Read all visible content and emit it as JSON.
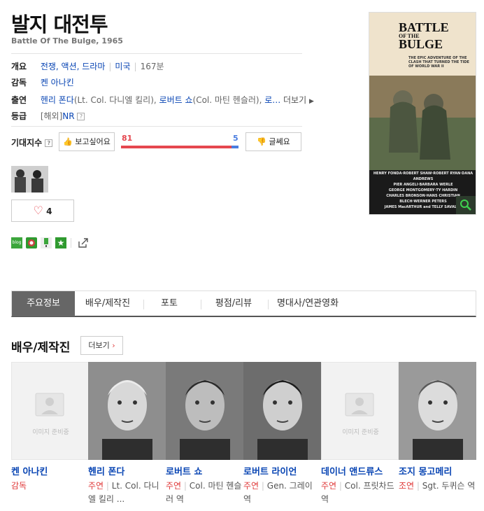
{
  "movie": {
    "title": "발지 대전투",
    "subtitle": "Battle Of The Bulge, 1965"
  },
  "info": {
    "overview_label": "개요",
    "genres": "전쟁, 액션, 드라마",
    "country": "미국",
    "runtime": "167분",
    "director_label": "감독",
    "director": "켄 아나킨",
    "cast_label": "출연",
    "cast_1": "헨리 폰다",
    "cast_1_role": "(Lt. Col. 다니엘 킬리),",
    "cast_2": "로버트 쇼",
    "cast_2_role": "(Col. 마틴 헨슬러),",
    "cast_3": "로…",
    "more_label": "더보기",
    "rating_label": "등급",
    "rating_region": "[해외]",
    "rating_value": "NR",
    "qmark": "?"
  },
  "expect": {
    "label": "기대지수",
    "qmark": "?",
    "want_label": "보고싶어요",
    "meh_label": "글쎄요",
    "want_count": "81",
    "meh_count": "5",
    "want_ratio": 0.942
  },
  "like": {
    "count": "4"
  },
  "share": {
    "blog_label": "blog"
  },
  "poster": {
    "title_line1": "BATTLE",
    "title_line2": "OF THE",
    "title_line3": "BULGE",
    "tagline": "THE EPIC ADVENTURE OF THE CLASH THAT TURNED THE TIDE OF WORLD WAR II",
    "credits_1": "HENRY FONDA·ROBERT SHAW·ROBERT RYAN·DANA ANDREWS",
    "credits_2": "PIER ANGELI·BARBARA WERLE",
    "credits_3": "GEORGE MONTGOMERY·TY HARDIN",
    "credits_4": "CHARLES BRONSON·HANS CHRISTIAN BLECH·WERNER PETERS",
    "credits_5": "JAMES MacARTHUR and TELLY SAVALAS"
  },
  "tabs": [
    "주요정보",
    "배우/제작진",
    "포토",
    "평점/리뷰",
    "명대사/연관영화"
  ],
  "cast_section": {
    "title": "배우/제작진",
    "more_label": "더보기",
    "no_image_label": "이미지 준비중",
    "people": [
      {
        "name": "켄 아나킨",
        "role": "감독",
        "desc": "",
        "photo": false
      },
      {
        "name": "헨리 폰다",
        "role": "주연",
        "desc": "Lt. Col. 다니엘 킬리 ...",
        "photo": true
      },
      {
        "name": "로버트 쇼",
        "role": "주연",
        "desc": "Col. 마틴 헨슬러 역",
        "photo": true
      },
      {
        "name": "로버트 라이언",
        "role": "주연",
        "desc": "Gen. 그레이 역",
        "photo": true
      },
      {
        "name": "데이너 앤드류스",
        "role": "주연",
        "desc": "Col. 프릿차드 역",
        "photo": false
      },
      {
        "name": "조지 몽고메리",
        "role": "조연",
        "desc": "Sgt. 두퀴슨 역",
        "photo": true
      }
    ]
  },
  "colors": {
    "link": "#0a46b4",
    "like_red": "#e5474f",
    "dislike_blue": "#4a7de0",
    "active_tab": "#666666",
    "role_red": "#e03c3c"
  }
}
